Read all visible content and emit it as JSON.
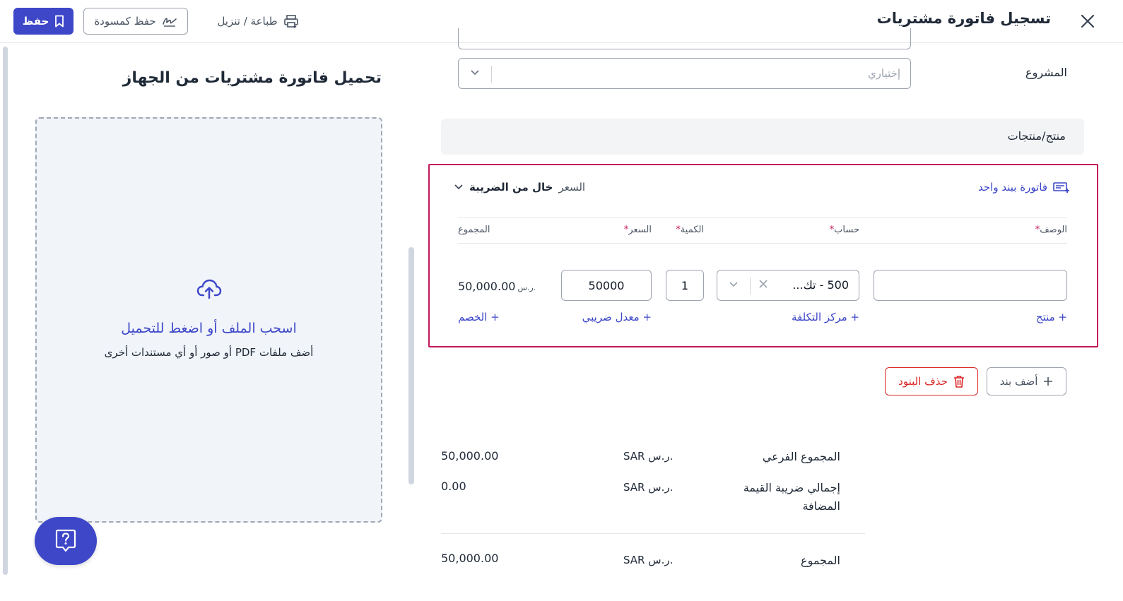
{
  "header": {
    "title": "تسجيل فاتورة مشتريات",
    "save_label": "حفظ",
    "draft_label": "حفظ كمسودة",
    "print_label": "طباعة / تنزيل"
  },
  "upload": {
    "title": "تحميل فاتورة مشتريات من الجهاز",
    "main_text": "اسحب الملف أو اضغط للتحميل",
    "sub_text": "أضف ملفات PDF أو صور أو أي مستندات أخرى"
  },
  "form": {
    "project_label": "المشروع",
    "project_placeholder": "إختياري",
    "products_heading": "منتج/منتجات"
  },
  "line_items": {
    "single_invoice_label": "فاتورة ببند واحد",
    "price_prefix": "السعر",
    "price_mode": "خال من الضريبة",
    "columns": {
      "description": "الوصف",
      "account": "حساب",
      "quantity": "الكمية",
      "price": "السعر",
      "total": "المجموع"
    },
    "row": {
      "account_value": "500 - تك...",
      "quantity": "1",
      "price": "50000",
      "total_amount": "50,000.00",
      "total_currency": "ر.س."
    },
    "links": {
      "product": "+ منتج",
      "cost_center": "+ مركز التكلفة",
      "tax_rate": "+ معدل ضريبي",
      "discount": "+ الخصم"
    }
  },
  "actions": {
    "add_line": "أضف بند",
    "delete_lines": "حذف البنود"
  },
  "summary": {
    "currency": "SAR ر.س.",
    "rows": [
      {
        "label": "المجموع الفرعي",
        "value": "50,000.00"
      },
      {
        "label": "إجمالي ضريبة القيمة المضافة",
        "value": "0.00"
      },
      {
        "label": "المجموع",
        "value": "50,000.00"
      }
    ]
  },
  "colors": {
    "primary": "#3d47c8",
    "highlight_border": "#c2185b",
    "danger": "#dc2626"
  }
}
